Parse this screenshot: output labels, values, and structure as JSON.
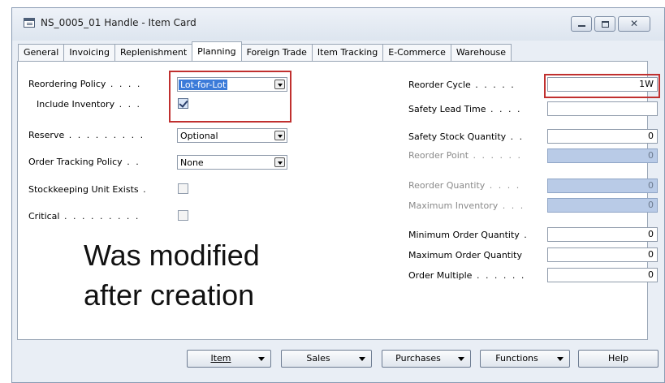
{
  "window": {
    "title": "NS_0005_01 Handle - Item Card",
    "close_glyph": "✕"
  },
  "tabs": [
    "General",
    "Invoicing",
    "Replenishment",
    "Planning",
    "Foreign Trade",
    "Item Tracking",
    "E-Commerce",
    "Warehouse"
  ],
  "active_tab": "Planning",
  "left": {
    "reordering_policy": {
      "label": "Reordering Policy",
      "value": "Lot-for-Lot"
    },
    "include_inventory": {
      "label": "Include Inventory",
      "checked": true
    },
    "reserve": {
      "label": "Reserve",
      "value": "Optional"
    },
    "order_tracking_policy": {
      "label": "Order Tracking Policy",
      "value": "None"
    },
    "stockkeeping_unit_exists": {
      "label": "Stockkeeping Unit Exists",
      "checked": false
    },
    "critical": {
      "label": "Critical",
      "checked": false
    }
  },
  "right": {
    "reorder_cycle": {
      "label": "Reorder Cycle",
      "value": "1W"
    },
    "safety_lead_time": {
      "label": "Safety Lead Time",
      "value": ""
    },
    "safety_stock_quantity": {
      "label": "Safety Stock Quantity",
      "value": "0"
    },
    "reorder_point": {
      "label": "Reorder Point",
      "value": "0"
    },
    "reorder_quantity": {
      "label": "Reorder Quantity",
      "value": "0"
    },
    "maximum_inventory": {
      "label": "Maximum Inventory",
      "value": "0"
    },
    "minimum_order_quantity": {
      "label": "Minimum Order Quantity",
      "value": "0"
    },
    "maximum_order_quantity": {
      "label": "Maximum Order Quantity",
      "value": "0"
    },
    "order_multiple": {
      "label": "Order Multiple",
      "value": "0"
    }
  },
  "annotation": {
    "line1": "Was modified",
    "line2": "after creation"
  },
  "buttons": {
    "item": "Item",
    "sales": "Sales",
    "purchases": "Purchases",
    "functions": "Functions",
    "help": "Help"
  },
  "colors": {
    "highlight": "#c0302f",
    "selection": "#3b7bd9",
    "disabled_field": "#b9cbe7"
  }
}
